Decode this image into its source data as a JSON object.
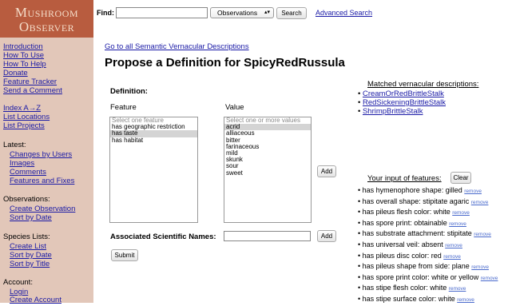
{
  "logo": {
    "line1": "Mushroom",
    "line2": "Observer"
  },
  "search": {
    "label": "Find:",
    "value": "",
    "type_selected": "Observations",
    "button": "Search",
    "advanced_link": "Advanced Search"
  },
  "sidebar": {
    "intro": "Introduction",
    "how_to_use": "How To Use",
    "how_to_help": "How To Help",
    "donate": "Donate",
    "feature_tracker": "Feature Tracker",
    "send_comment": "Send a Comment",
    "index": "Index A→Z",
    "list_locations": "List Locations",
    "list_projects": "List Projects",
    "latest_heading": "Latest:",
    "changes_by_users": "Changes by Users",
    "images": "Images",
    "comments": "Comments",
    "features_fixes": "Features and Fixes",
    "observations_heading": "Observations:",
    "create_observation": "Create Observation",
    "obs_sort_by_date": "Sort by Date",
    "species_heading": "Species Lists:",
    "create_list": "Create List",
    "species_sort_by_date": "Sort by Date",
    "sort_by_title": "Sort by Title",
    "account_heading": "Account:",
    "login": "Login",
    "create_account": "Create Account"
  },
  "main": {
    "goto_link": "Go to all Semantic Vernacular Descriptions",
    "title": "Propose a Definition for SpicyRedRussula",
    "definition_label": "Definition:",
    "feature_col": "Feature",
    "value_col": "Value",
    "feature_placeholder": "Select one feature",
    "features": [
      "has geographic restriction",
      "has taste",
      "has habitat"
    ],
    "value_placeholder": "Select one or more values",
    "values": [
      "acrid",
      "alliaceous",
      "bitter",
      "farinaceous",
      "mild",
      "skunk",
      "sour",
      "sweet"
    ],
    "add_label": "Add",
    "assoc_label": "Associated Scientific Names:",
    "assoc_value": "",
    "add2_label": "Add",
    "submit_label": "Submit"
  },
  "matched": {
    "heading": "Matched vernacular descriptions:",
    "items": [
      "CreamOrRedBrittleStalk",
      "RedSickeningBrittleStalk",
      "ShrimpBrittleStalk"
    ]
  },
  "input": {
    "heading": "Your input of features:",
    "clear_label": "Clear",
    "remove_label": "remove",
    "items": [
      "has hymenophore shape: gilled",
      "has overall shape: stipitate agaric",
      "has pileus flesh color: white",
      "has spore print: obtainable",
      "has substrate attachment: stipitate",
      "has universal veil: absent",
      "has pileus disc color: red",
      "has pileus shape from side: plane",
      "has spore print color: white or yellow",
      "has stipe flesh color: white",
      "has stipe surface color: white"
    ]
  }
}
